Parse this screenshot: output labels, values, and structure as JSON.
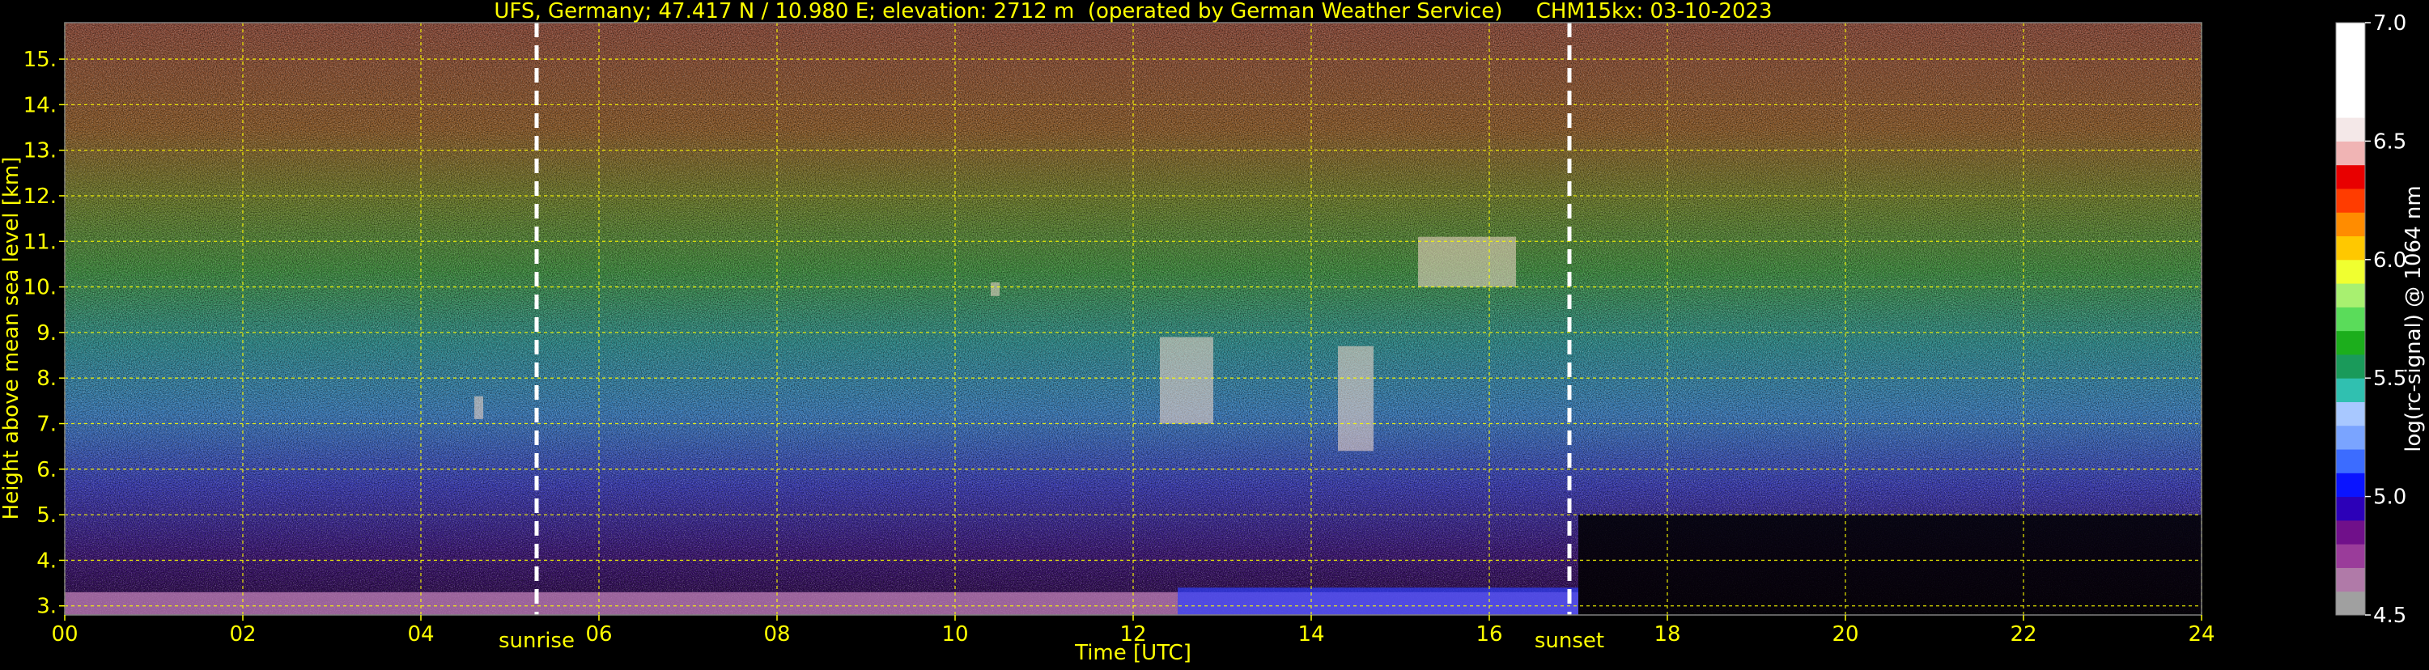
{
  "chart_data": {
    "type": "heatmap",
    "title": "UFS, Germany; 47.417 N / 10.980 E; elevation: 2712 m  (operated by German Weather Service)     CHM15kx: 03-10-2023",
    "xlabel": "Time [UTC]",
    "ylabel": "Height above mean sea level [km]",
    "xlim": [
      0,
      24
    ],
    "ylim": [
      2.8,
      15.8
    ],
    "x_ticks": [
      0,
      2,
      4,
      6,
      8,
      10,
      12,
      14,
      16,
      18,
      20,
      22,
      24
    ],
    "x_tick_labels": [
      "00",
      "02",
      "04",
      "06",
      "08",
      "10",
      "12",
      "14",
      "16",
      "18",
      "20",
      "22",
      "24"
    ],
    "y_ticks": [
      3,
      4,
      5,
      6,
      7,
      8,
      9,
      10,
      11,
      12,
      13,
      14,
      15
    ],
    "y_tick_labels": [
      "3.",
      "4.",
      "5.",
      "6.",
      "7.",
      "8.",
      "9.",
      "10.",
      "11.",
      "12.",
      "13.",
      "14.",
      "15."
    ],
    "grid": true,
    "markers": [
      {
        "label": "sunrise",
        "x": 5.3
      },
      {
        "label": "sunset",
        "x": 16.9
      }
    ],
    "colorbar": {
      "label": "log(rc-signal) @ 1064 nm",
      "range": [
        4.5,
        7.0
      ],
      "ticks": [
        4.5,
        5.0,
        5.5,
        6.0,
        6.5,
        7.0
      ],
      "tick_labels": [
        "4.5",
        "5.0",
        "5.5",
        "6.0",
        "6.5",
        "7.0"
      ],
      "levels": [
        {
          "v": 4.5,
          "c": "#a0a0a0"
        },
        {
          "v": 4.6,
          "c": "#b07aa8"
        },
        {
          "v": 4.7,
          "c": "#9a3c9a"
        },
        {
          "v": 4.8,
          "c": "#70108a"
        },
        {
          "v": 4.9,
          "c": "#2c00b8"
        },
        {
          "v": 5.0,
          "c": "#0a14ff"
        },
        {
          "v": 5.1,
          "c": "#3c6cff"
        },
        {
          "v": 5.2,
          "c": "#7aa4ff"
        },
        {
          "v": 5.3,
          "c": "#a8c8ff"
        },
        {
          "v": 5.4,
          "c": "#30c0b0"
        },
        {
          "v": 5.5,
          "c": "#1a9a5a"
        },
        {
          "v": 5.6,
          "c": "#1cae1c"
        },
        {
          "v": 5.7,
          "c": "#5adc5a"
        },
        {
          "v": 5.8,
          "c": "#a8f070"
        },
        {
          "v": 5.9,
          "c": "#f0ff30"
        },
        {
          "v": 6.0,
          "c": "#ffc800"
        },
        {
          "v": 6.1,
          "c": "#ff8c00"
        },
        {
          "v": 6.2,
          "c": "#ff3c00"
        },
        {
          "v": 6.3,
          "c": "#e80000"
        },
        {
          "v": 6.4,
          "c": "#f0b4b4"
        },
        {
          "v": 6.5,
          "c": "#f4e8e8"
        },
        {
          "v": 6.6,
          "c": "#ffffff"
        }
      ]
    },
    "colors": {
      "text": "#ffff00",
      "grid": "#ffff00",
      "background": "#000000"
    }
  }
}
